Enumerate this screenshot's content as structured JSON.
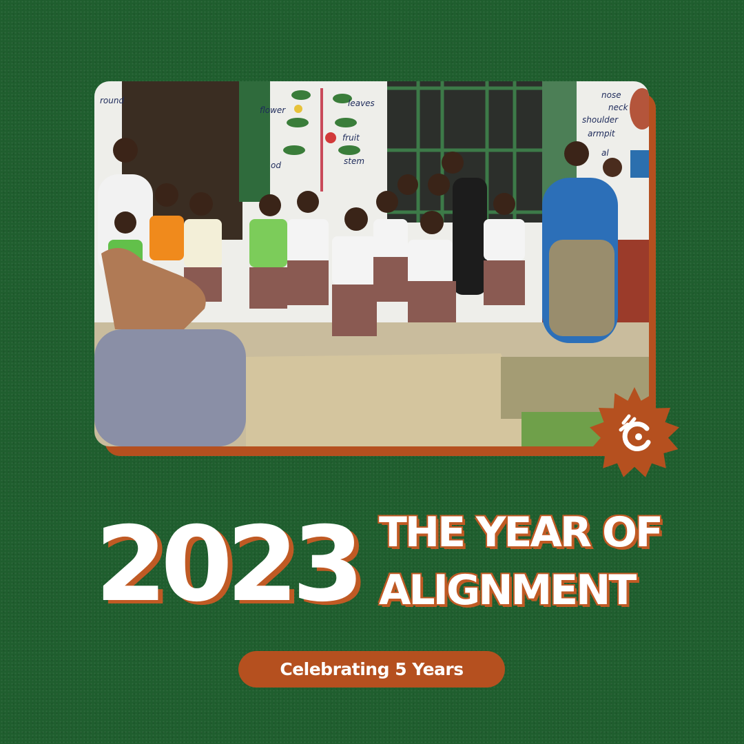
{
  "photo": {
    "wall_labels": {
      "leaves": "leaves",
      "fruit": "fruit",
      "stem": "stem",
      "flower": "flower",
      "nose": "nose",
      "neck": "neck",
      "shoulder": "shoulder",
      "armpit": "armpit",
      "round": "round",
      "od": "od",
      "al": "al"
    }
  },
  "logo": {
    "icon": "hand-logo-icon",
    "color": "#b5501f"
  },
  "headline": {
    "year": "2023",
    "line1": "THE YEAR OF",
    "line2": "ALIGNMENT"
  },
  "tagline": "Celebrating 5 Years",
  "colors": {
    "background": "#1f5e2e",
    "accent": "#b5501f",
    "text": "#ffffff"
  }
}
